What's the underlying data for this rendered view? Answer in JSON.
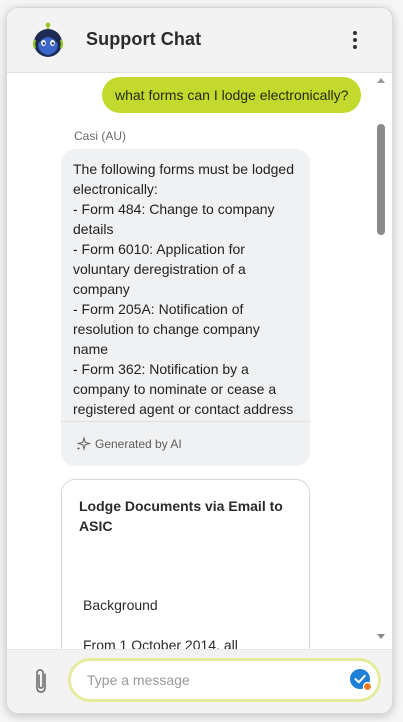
{
  "header": {
    "title": "Support Chat",
    "avatar_icon": "robot-avatar-icon",
    "menu_icon": "more-vertical-icon"
  },
  "conversation": {
    "user_message": "what forms can I lodge electronically?",
    "bot_sender": "Casi (AU)",
    "bot_message_lines": [
      "The following forms must be lodged",
      "electronically:",
      "- Form 484: Change to company",
      "details",
      "- Form 6010: Application for",
      "voluntary deregistration of a",
      "company",
      "- Form 205A: Notification of",
      "resolution to change company",
      "name",
      "- Form 362: Notification by a",
      "company to nominate or cease a",
      "registered agent or contact address"
    ],
    "ai_badge": "Generated by AI",
    "card": {
      "title": "Lodge Documents via Email to ASIC",
      "body_1": "Background",
      "body_2": "From 1 October 2014, all"
    }
  },
  "composer": {
    "placeholder": "Type a message",
    "value": "",
    "attach_icon": "paperclip-icon",
    "send_icon": "send-icon"
  },
  "colors": {
    "user_bubble": "#c4d92e",
    "input_border": "#e4ec9b",
    "send_button": "#1e7fd6",
    "avatar_bg": "#1d2a55"
  }
}
